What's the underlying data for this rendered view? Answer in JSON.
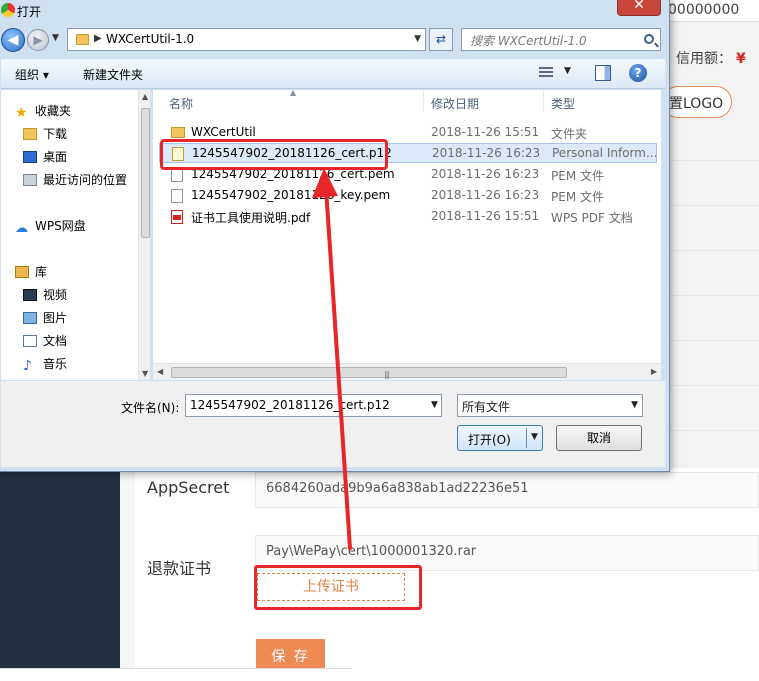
{
  "background": {
    "top_input_value": "00000000",
    "credit_label": "信用额：",
    "credit_currency": "¥",
    "logo_button": "置LOGO",
    "appsecret_label": "AppSecret",
    "appsecret_value": "6684260ada9b9a6a838ab1ad22236e51",
    "refund_cert_label": "退款证书",
    "cert_path": "Pay\\WePay\\cert\\1000001320.rar",
    "upload_button": "上传证书",
    "save_button": "保 存"
  },
  "dialog": {
    "title": "打开",
    "close": "✕",
    "address": "WXCertUtil-1.0",
    "search_placeholder": "搜索 WXCertUtil-1.0",
    "toolbar": {
      "organize": "组织 ▾",
      "new_folder": "新建文件夹"
    },
    "nav": {
      "favorites": "收藏夹",
      "downloads": "下载",
      "desktop": "桌面",
      "recent": "最近访问的位置",
      "wps_cloud": "WPS网盘",
      "libraries": "库",
      "videos": "视频",
      "pictures": "图片",
      "documents": "文档",
      "music": "音乐"
    },
    "columns": {
      "name": "名称",
      "modified": "修改日期",
      "type": "类型"
    },
    "files": [
      {
        "name": "WXCertUtil",
        "date": "2018-11-26 15:51",
        "type": "文件夹",
        "icon": "folder-icon"
      },
      {
        "name": "1245547902_20181126_cert.p12",
        "date": "2018-11-26 16:23",
        "type": "Personal Inform...",
        "icon": "certificate-icon"
      },
      {
        "name": "1245547902_20181126_cert.pem",
        "date": "2018-11-26 16:23",
        "type": "PEM 文件",
        "icon": "file-icon"
      },
      {
        "name": "1245547902_20181126_key.pem",
        "date": "2018-11-26 16:23",
        "type": "PEM 文件",
        "icon": "file-icon"
      },
      {
        "name": "证书工具使用说明.pdf",
        "date": "2018-11-26 15:51",
        "type": "WPS PDF 文档",
        "icon": "pdf-icon"
      }
    ],
    "filename_label": "文件名(N):",
    "filename_value": "1245547902_20181126_cert.p12",
    "filetype_value": "所有文件",
    "open_button": "打开(O)",
    "cancel_button": "取消"
  },
  "colors": {
    "annotation_red": "#e8262a",
    "accent_orange": "#f08a55",
    "selection_blue": "#dbe9f8"
  }
}
